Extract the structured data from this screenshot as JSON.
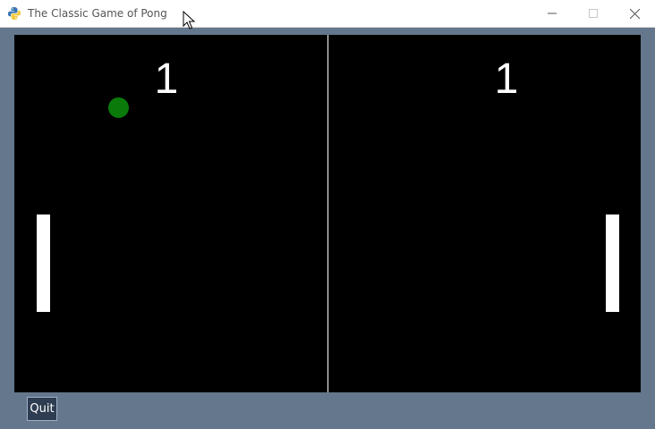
{
  "window": {
    "title": "The Classic Game of Pong",
    "app_icon": "python-icon",
    "controls": [
      "minimize-icon",
      "maximize-icon",
      "close-icon"
    ]
  },
  "game": {
    "score_left": "1",
    "score_right": "1",
    "ball_color": "#0a7a0a",
    "paddle_color": "#ffffff",
    "court_color": "#000000"
  },
  "footer": {
    "quit_label": "Quit"
  },
  "colors": {
    "frame": "#64778c",
    "button": "#2e3d52"
  }
}
